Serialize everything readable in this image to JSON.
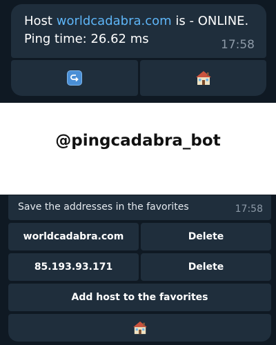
{
  "top_message": {
    "prefix": "Host ",
    "host_link": "worldcadabra.com",
    "suffix": " is - ONLINE.",
    "ping_line": "Ping time: 26.62 ms",
    "time": "17:58"
  },
  "top_keyboard": {
    "back_icon": "return-arrow-icon",
    "home_icon": "house-icon"
  },
  "bot_name": "@pingcadabra_bot",
  "bottom_message": {
    "text": "Save the addresses in the favorites",
    "time": "17:58"
  },
  "bottom_keyboard": {
    "rows": [
      {
        "host": "worldcadabra.com",
        "action": "Delete"
      },
      {
        "host": "85.193.93.171",
        "action": "Delete"
      }
    ],
    "add_label": "Add host to the favorites",
    "home_icon": "house-icon"
  },
  "colors": {
    "background": "#0f1923",
    "bubble": "#1f2e3c",
    "link": "#5eb5f7",
    "timestamp": "#8d9aa7"
  }
}
